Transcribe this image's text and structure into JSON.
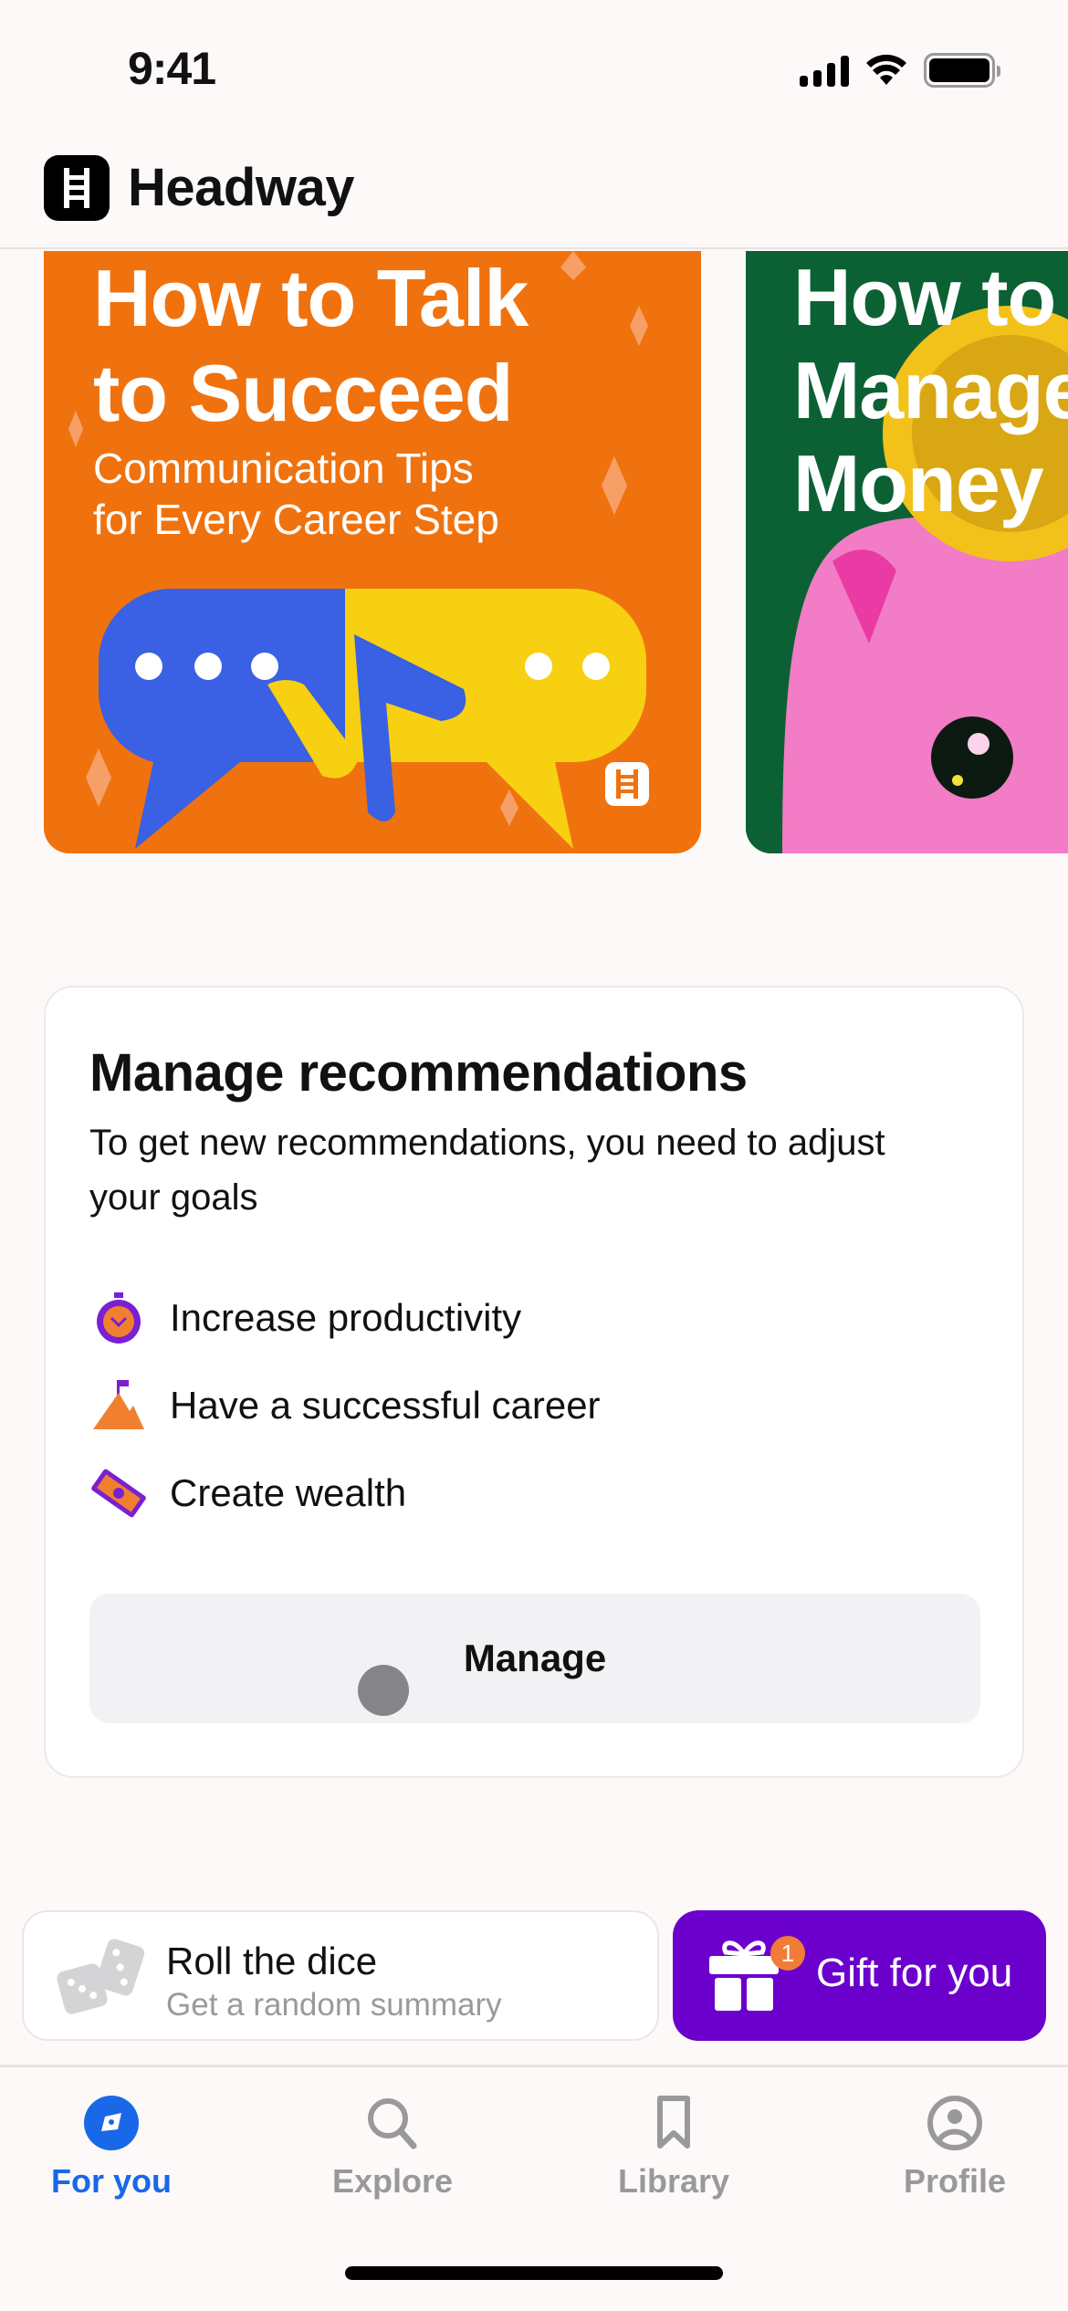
{
  "status_bar": {
    "time": "9:41"
  },
  "header": {
    "app_name": "Headway"
  },
  "carousel": [
    {
      "title_line1": "How to Talk",
      "title_line2": "to Succeed",
      "subtitle_line1": "Communication Tips",
      "subtitle_line2": "for Every Career Step",
      "color": "#f0720e"
    },
    {
      "title_line1": "How to",
      "title_line2": "Manage",
      "title_line3": "Money",
      "color": "#0b6134"
    }
  ],
  "recommendations": {
    "title": "Manage recommendations",
    "description": "To get new recommendations, you need to adjust your goals",
    "goals": [
      {
        "icon": "stopwatch-icon",
        "label": "Increase productivity"
      },
      {
        "icon": "mountain-flag-icon",
        "label": "Have a successful career"
      },
      {
        "icon": "banknote-icon",
        "label": "Create wealth"
      }
    ],
    "button_label": "Manage"
  },
  "dice": {
    "title": "Roll the dice",
    "subtitle": "Get a random summary"
  },
  "gift": {
    "label": "Gift for you",
    "badge_count": "1",
    "color": "#6b00cc"
  },
  "tabs": [
    {
      "label": "For you",
      "icon": "compass-icon",
      "active": true
    },
    {
      "label": "Explore",
      "icon": "search-icon",
      "active": false
    },
    {
      "label": "Library",
      "icon": "bookmark-icon",
      "active": false
    },
    {
      "label": "Profile",
      "icon": "profile-icon",
      "active": false
    }
  ],
  "colors": {
    "accent": "#1968e8",
    "inactive": "#999999"
  }
}
